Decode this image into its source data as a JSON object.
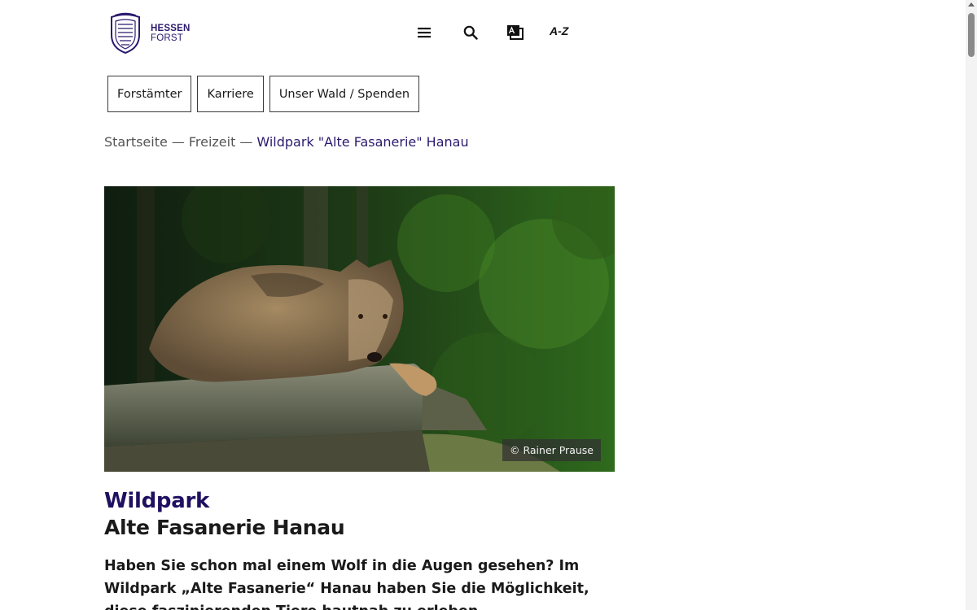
{
  "header": {
    "logo_line1": "HESSEN",
    "logo_line2": "FORST",
    "menu_icon": "hamburger-menu-icon",
    "search_icon": "search-icon",
    "language_icon": "easy-language-icon",
    "az_label": "A-Z"
  },
  "quicknav": [
    {
      "label": "Forstämter"
    },
    {
      "label": "Karriere"
    },
    {
      "label": "Unser Wald / Spenden"
    }
  ],
  "breadcrumb": {
    "items": [
      "Startseite",
      "Freizeit"
    ],
    "separator": "—",
    "current": "Wildpark \"Alte Fasanerie\" Hanau"
  },
  "hero": {
    "credit": "© Rainer Prause"
  },
  "article": {
    "title": "Wildpark",
    "subtitle": "Alte Fasanerie Hanau",
    "lead": "Haben Sie schon mal einem Wolf in die Augen gesehen? Im Wildpark „Alte Fasanerie“ Hanau haben Sie die Möglichkeit, diese faszinierenden Tiere hautnah zu erleben."
  },
  "colors": {
    "brand": "#2b1a6e",
    "title": "#1f1060",
    "text": "#1a1a1a"
  }
}
